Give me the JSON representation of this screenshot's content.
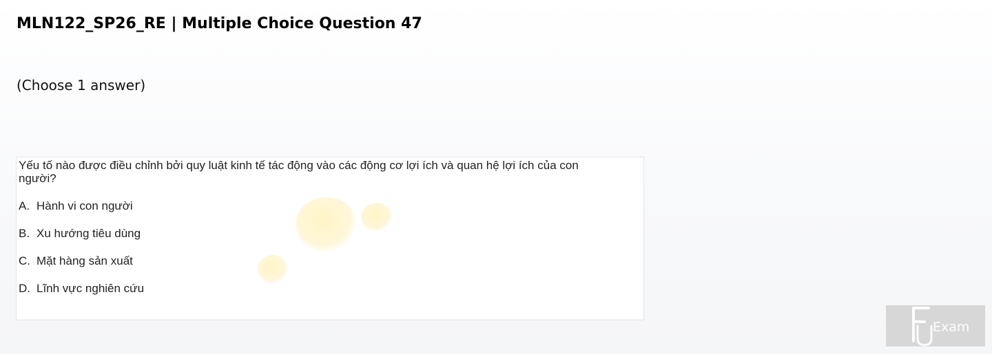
{
  "header": {
    "title": "MLN122_SP26_RE | Multiple Choice Question 47"
  },
  "instruction": "(Choose 1 answer)",
  "question": {
    "text": "Yếu tố nào được điều chỉnh bởi quy luật kinh tế tác động vào các động cơ lợi ích và quan hệ lợi ích của con người?",
    "options": [
      {
        "letter": "A.",
        "text": "Hành vi con người"
      },
      {
        "letter": "B.",
        "text": "Xu hướng tiêu dùng"
      },
      {
        "letter": "C.",
        "text": "Mặt hàng sản xuất"
      },
      {
        "letter": "D.",
        "text": "Lĩnh vực nghiên cứu"
      }
    ]
  },
  "logo": {
    "text": "Exam",
    "icon": "fu-exam-logo"
  },
  "colors": {
    "watermark": "#fff0b0",
    "logo_bg": "#d2d2d2"
  }
}
